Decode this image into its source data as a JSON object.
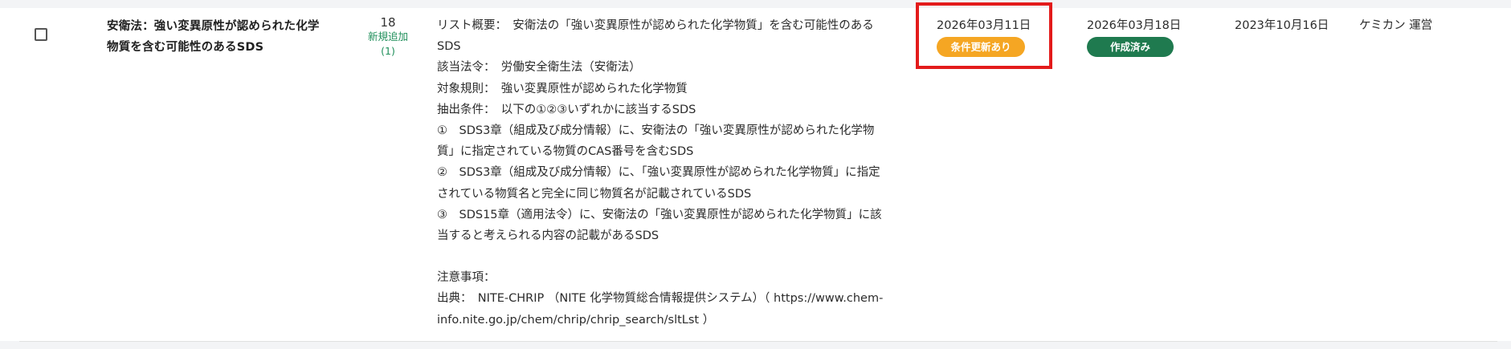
{
  "row": {
    "list_name_line1": "安衛法：強い変異原性が認められた化学",
    "list_name_line2": "物質を含む可能性のあるSDS",
    "count": "18",
    "count_new_label": "新規追加",
    "count_new_value": "(1)",
    "overview_lines": [
      "リスト概要：　安衛法の「強い変異原性が認められた化学物質」を含む可能性のある",
      "SDS",
      "該当法令：　労働安全衛生法（安衛法）",
      "対象規則：　強い変異原性が認められた化学物質",
      "抽出条件：　以下の①②③いずれかに該当するSDS",
      "①　SDS3章（組成及び成分情報）に、安衛法の「強い変異原性が認められた化学物",
      "質」に指定されている物質のCAS番号を含むSDS",
      "②　SDS3章（組成及び成分情報）に、「強い変異原性が認められた化学物質」に指定",
      "されている物質名と完全に同じ物質名が記載されているSDS",
      "③　SDS15章（適用法令）に、安衛法の「強い変異原性が認められた化学物質」に該",
      "当すると考えられる内容の記載があるSDS",
      "",
      "注意事項：",
      "出典：　NITE-CHRIP （NITE 化学物質総合情報提供システム）（ https://www.chem-",
      "info.nite.go.jp/chem/chrip/chrip_search/sltLst ）"
    ],
    "condition_update_date": "2026年03月11日",
    "condition_update_badge": "条件更新あり",
    "created_date": "2026年03月18日",
    "created_badge": "作成済み",
    "registered_date": "2023年10月16日",
    "operator": "ケミカン 運営"
  },
  "colors": {
    "badge_update": "#f5a623",
    "badge_created": "#1f7a4f",
    "new_count_text": "#1f8f5a",
    "highlight_border": "#e31b1b"
  }
}
